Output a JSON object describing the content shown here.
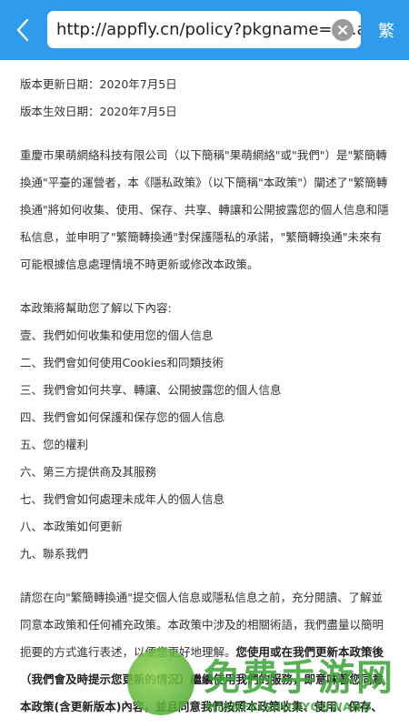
{
  "browser": {
    "url": "http://appfly.cn/policy?pkgname=cn.app",
    "trad_button": "繁"
  },
  "doc": {
    "updated": "版本更新日期：2020年7月5日",
    "effective": "版本生效日期：2020年7月5日",
    "intro": "重慶市果萌網絡科技有限公司（以下簡稱\"果萌網絡\"或\"我們\"）是\"繁簡轉換通\"平臺的運營者，本《隱私政策》（以下簡稱\"本政策\"）闡述了\"繁簡轉換通\"將如何收集、使用、保存、共享、轉讓和公開披露您的個人信息和隱私信息，並申明了\"繁簡轉換通\"對保護隱私的承諾，\"繁簡轉換通\"未來有可能根據信息處理情境不時更新或修改本政策。",
    "toc_title": "本政策將幫助您了解以下內容:",
    "toc": [
      "壹、我們如何收集和使用您的個人信息",
      "二、我們會如何使用Cookies和同類技術",
      "三、我們會如何共享、轉讓、公開披露您的個人信息",
      "四、我們會如何保護和保存您的個人信息",
      "五、您的權利",
      "六、第三方提供商及其服務",
      "七、我們會如何處理未成年人的個人信息",
      "八、本政策如何更新",
      "九、聯系我們"
    ],
    "closing_normal": "請您在向\"繁簡轉換通\"提交個人信息或隱私信息之前，充分閱讀、了解並同意本政策和任何補充政策。本政策中涉及的相關術語，我們盡量以簡明扼要的方式進行表述，以便您更好地理解。",
    "closing_bold": "您使用或在我們更新本政策後（我們會及時提示您更新的情況）繼續使用我們的服務，即意味著您同意本政策(含更新版本)內容，並且同意我們按照本政策收集、使用、保存、共享、轉讓和公開披露您的相關信息。"
  },
  "watermark": {
    "title": "免费手游网",
    "subtitle": "MIANFEISHOUYOUWANG"
  }
}
